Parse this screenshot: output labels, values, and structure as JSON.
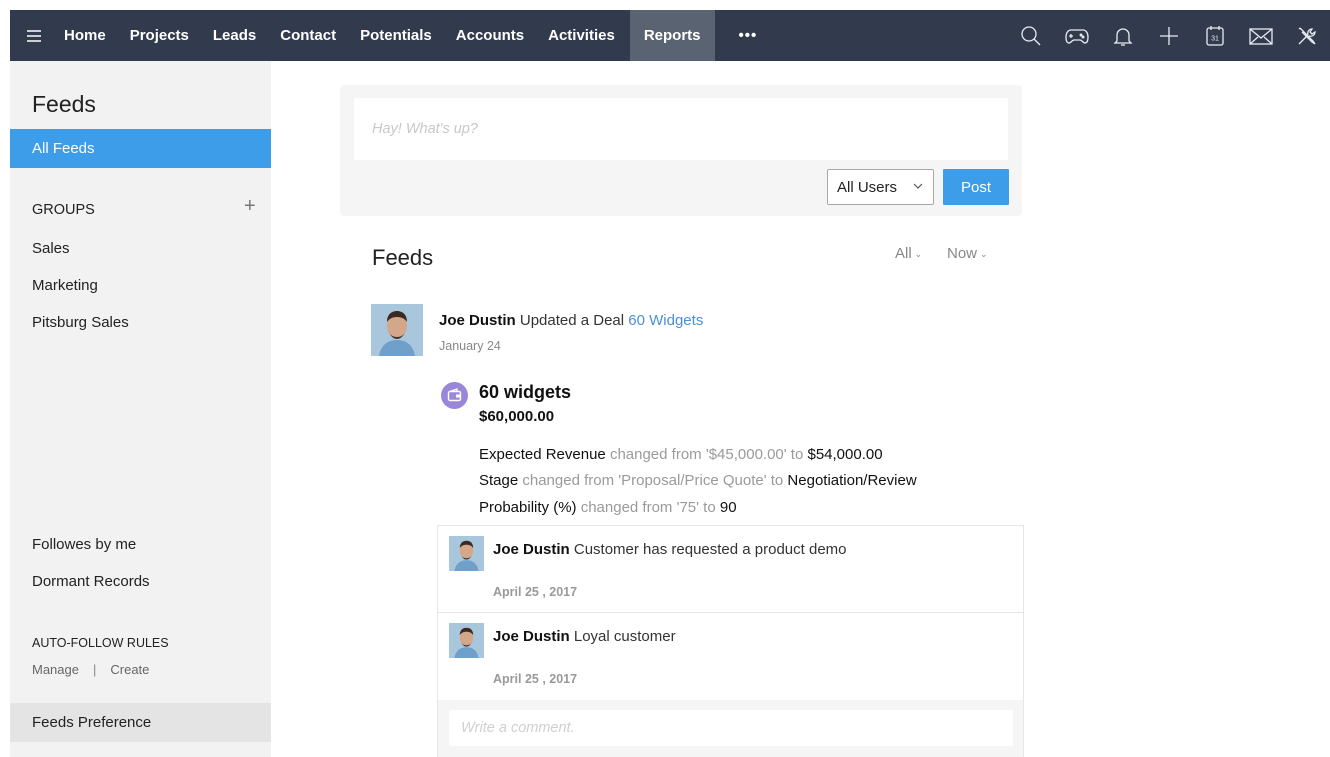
{
  "nav": {
    "menu_icon": "hamburger-menu-icon",
    "items": [
      "Home",
      "Projects",
      "Leads",
      "Contact",
      "Potentials",
      "Accounts",
      "Activities"
    ],
    "active": "Reports",
    "more": "•••",
    "right_icons": [
      "search-icon",
      "gamepad-icon",
      "bell-icon",
      "plus-icon",
      "calendar-icon",
      "mail-icon",
      "tools-icon"
    ],
    "calendar_day": "31",
    "colors": {
      "bar": "#323b4e",
      "active": "#5a6372"
    }
  },
  "sidebar": {
    "title": "Feeds",
    "all_feeds": "All Feeds",
    "groups_label": "GROUPS",
    "groups_add": "+",
    "groups": [
      "Sales",
      "Marketing",
      "Pitsburg Sales"
    ],
    "followed": "Followes by me",
    "dormant": "Dormant Records",
    "auto_follow_label": "AUTO-FOLLOW RULES",
    "manage": "Manage",
    "separator": "|",
    "create": "Create",
    "preference": "Feeds Preference",
    "colors": {
      "selected": "#3d9de8"
    }
  },
  "composer": {
    "placeholder": "Hay! What's up?",
    "user_select": "All Users",
    "post": "Post"
  },
  "feeds": {
    "title": "Feeds",
    "filter_all": "All",
    "filter_time": "Now"
  },
  "feed_item": {
    "user": "Joe Dustin",
    "action": "Updated a Deal",
    "deal_link": "60 Widgets",
    "date": "January 24",
    "deal_title": "60 widgets",
    "deal_amount": "$60,000.00",
    "changes": [
      {
        "field": "Expected Revenue",
        "from_text": "changed from '$45,000.00' to",
        "to": "$54,000.00"
      },
      {
        "field": "Stage",
        "from_text": "changed from 'Proposal/Price Quote' to",
        "to": "Negotiation/Review"
      },
      {
        "field": "Probability (%)",
        "from_text": "changed from '75' to",
        "to": "90"
      }
    ]
  },
  "comments": [
    {
      "user": "Joe Dustin",
      "text": "Customer has requested a product demo",
      "date": "April 25 , 2017"
    },
    {
      "user": "Joe Dustin",
      "text": "Loyal customer",
      "date": "April 25 , 2017"
    }
  ],
  "comment_box": {
    "placeholder": "Write a comment."
  }
}
